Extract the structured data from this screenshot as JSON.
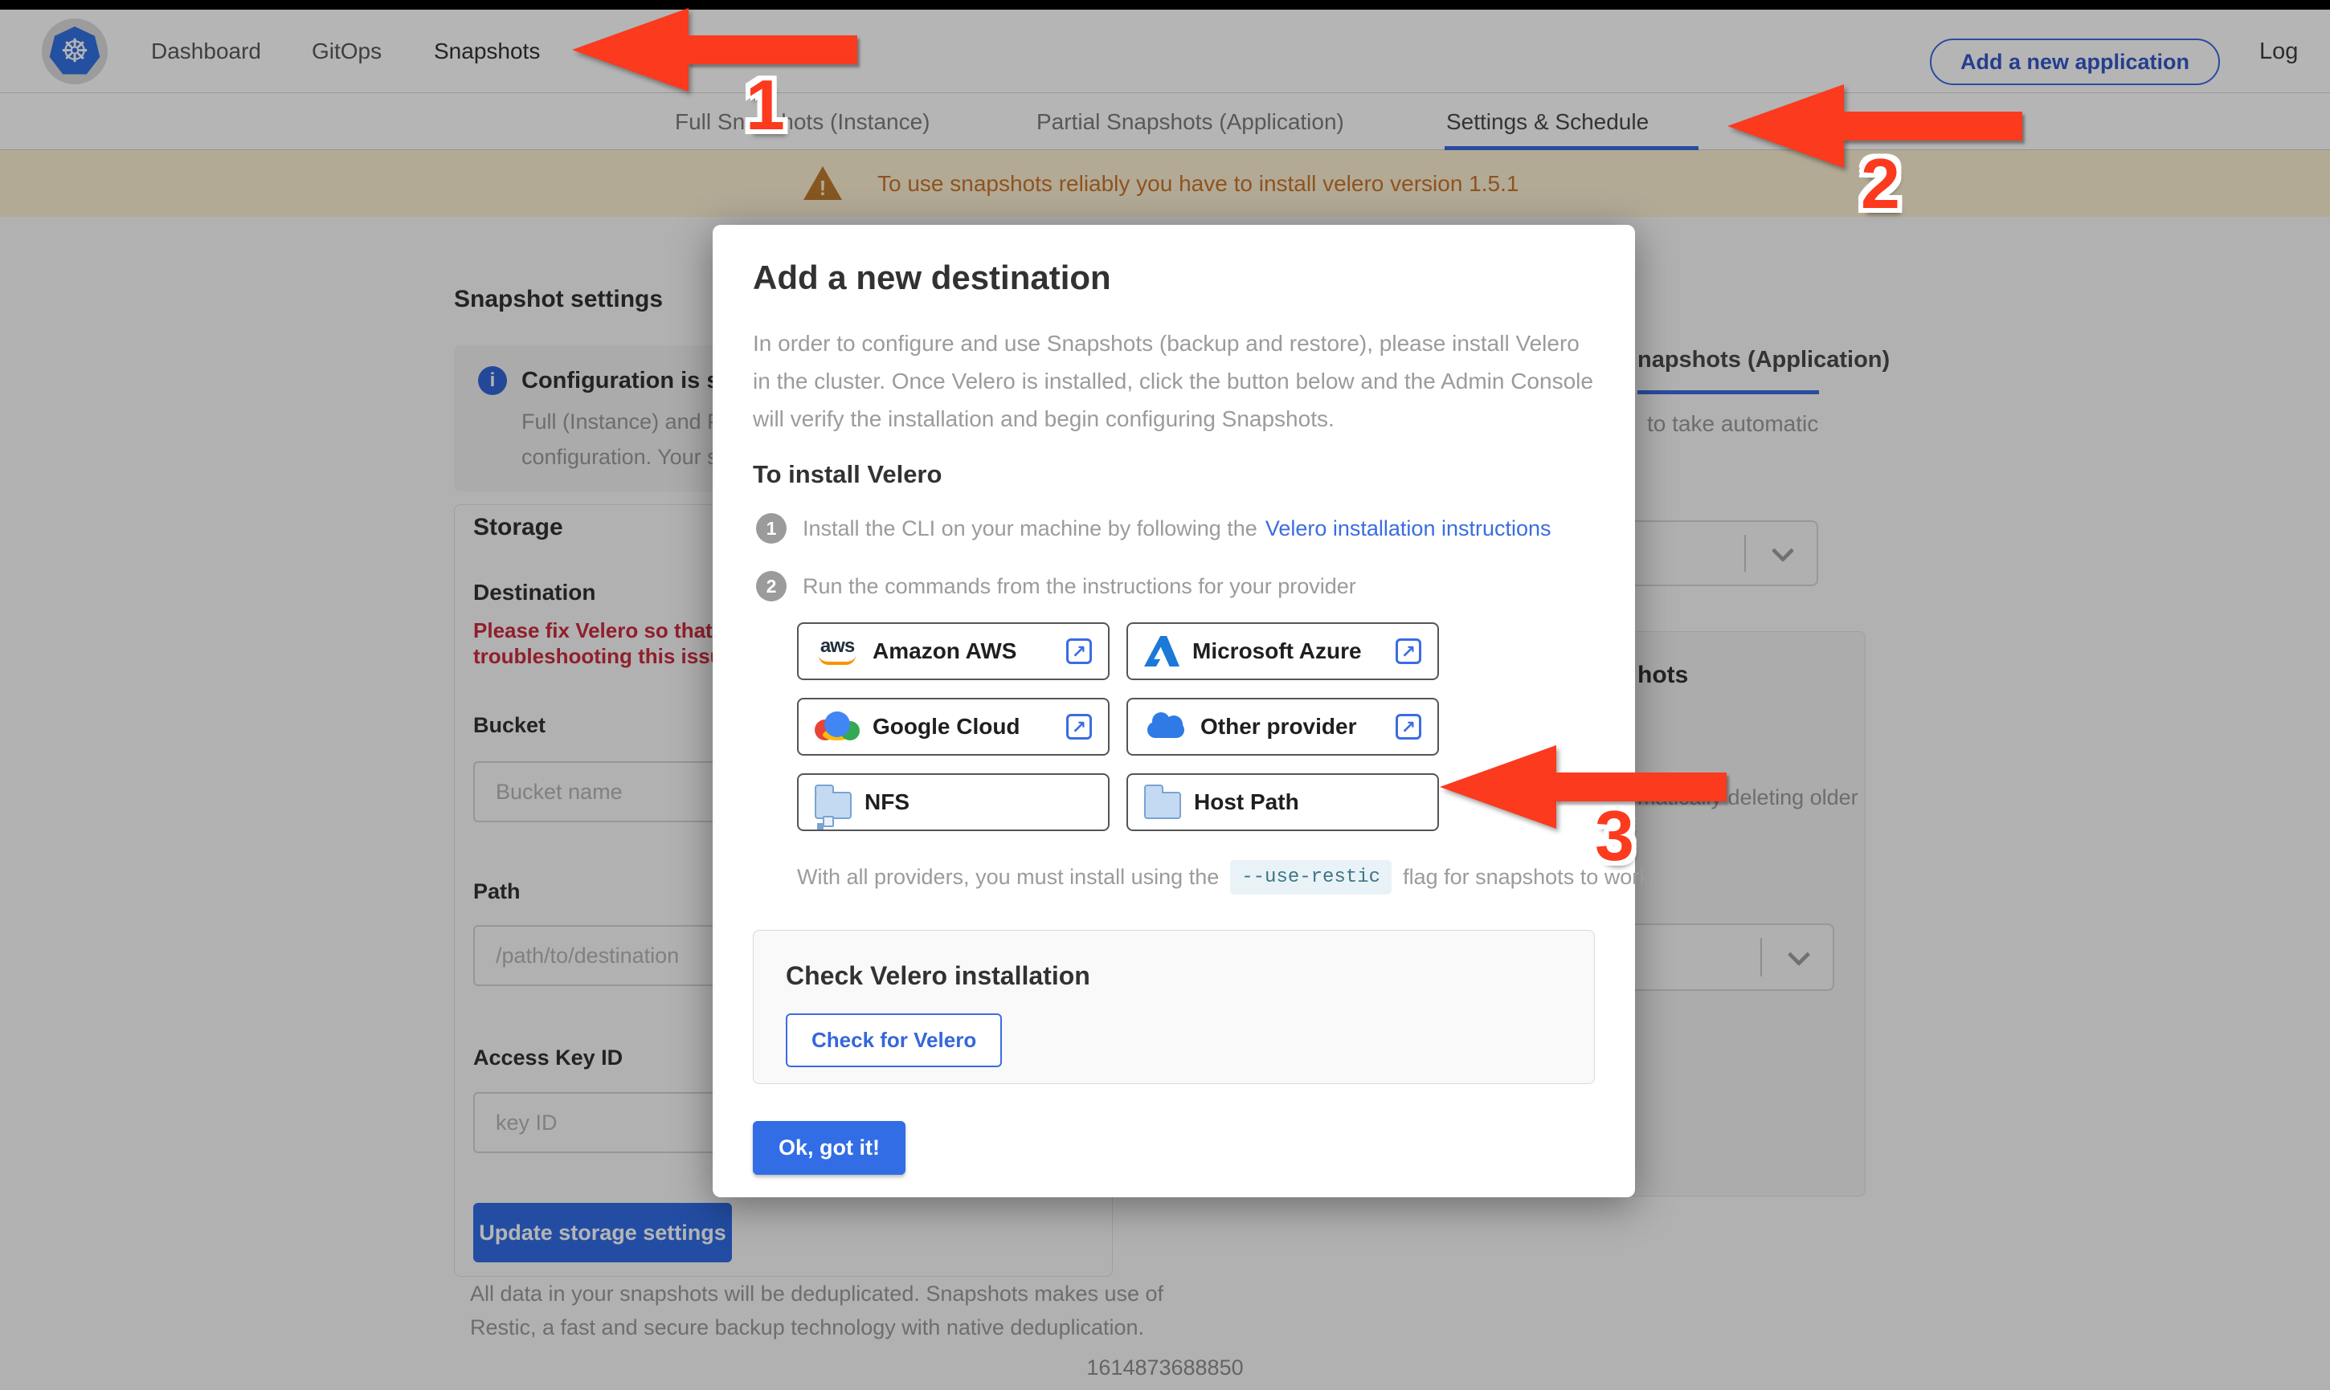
{
  "nav": {
    "brand": "kubernetes",
    "items": [
      {
        "label": "Dashboard"
      },
      {
        "label": "GitOps"
      },
      {
        "label": "Snapshots"
      }
    ],
    "add_app_label": "Add a new application",
    "logout_label": "Log out"
  },
  "subnav": {
    "tabs": [
      {
        "label": "Full Snapshots (Instance)"
      },
      {
        "label": "Partial Snapshots (Application)"
      },
      {
        "label": "Settings & Schedule"
      }
    ],
    "active": "Settings & Schedule"
  },
  "banner": {
    "text": "To use snapshots reliably you have to install velero version 1.5.1"
  },
  "page": {
    "title": "Snapshot settings",
    "info_box": {
      "title_fragment": "Configuration is sh",
      "line1": "Full (Instance) and Parti",
      "line2": "configuration. Your stor"
    },
    "storage": {
      "heading": "Storage",
      "destination_label": "Destination",
      "error_line1": "Please fix Velero so that th",
      "error_line2": "troubleshooting this issue",
      "bucket_label": "Bucket",
      "bucket_placeholder": "Bucket name",
      "path_label": "Path",
      "path_placeholder": "/path/to/destination",
      "access_key_label": "Access Key ID",
      "access_key_placeholder": "key ID",
      "update_button": "Update storage settings",
      "dedup_line1": "All data in your snapshots will be deduplicated. Snapshots makes use of",
      "dedup_line2": "Restic, a fast and secure backup technology with native deduplication."
    },
    "right": {
      "tab_fragment": "napshots (Application)",
      "schedule_fragment": "to take automatic",
      "retention_heading_fragment": "hots",
      "retention_fragment": "matically deleting older"
    },
    "footer_timestamp": "1614873688850"
  },
  "modal": {
    "title": "Add a new destination",
    "body": "In order to configure and use Snapshots (backup and restore), please install Velero in the cluster. Once Velero is installed, click the button below and the Admin Console will verify the installation and begin configuring Snapshots.",
    "install_heading": "To install Velero",
    "steps": [
      {
        "num": "1",
        "text": "Install the CLI on your machine by following the",
        "link": "Velero installation instructions"
      },
      {
        "num": "2",
        "text": "Run the commands from the instructions for your provider"
      }
    ],
    "providers": [
      {
        "label": "Amazon AWS"
      },
      {
        "label": "Microsoft Azure"
      },
      {
        "label": "Google Cloud"
      },
      {
        "label": "Other provider"
      },
      {
        "label": "NFS"
      },
      {
        "label": "Host Path"
      }
    ],
    "restic_note": {
      "prefix": "With all providers, you must install using the",
      "code": "--use-restic",
      "suffix": "flag for snapshots to work."
    },
    "check_box": {
      "heading": "Check Velero installation",
      "button": "Check for Velero"
    },
    "ok_button": "Ok, got it!"
  },
  "annotations": {
    "label1": "1",
    "label2": "2",
    "label3": "3"
  },
  "colors": {
    "accent": "#326de6",
    "arrow": "#fb3a1e",
    "warning_text": "#c9752c",
    "error_text": "#cc2b3e"
  }
}
